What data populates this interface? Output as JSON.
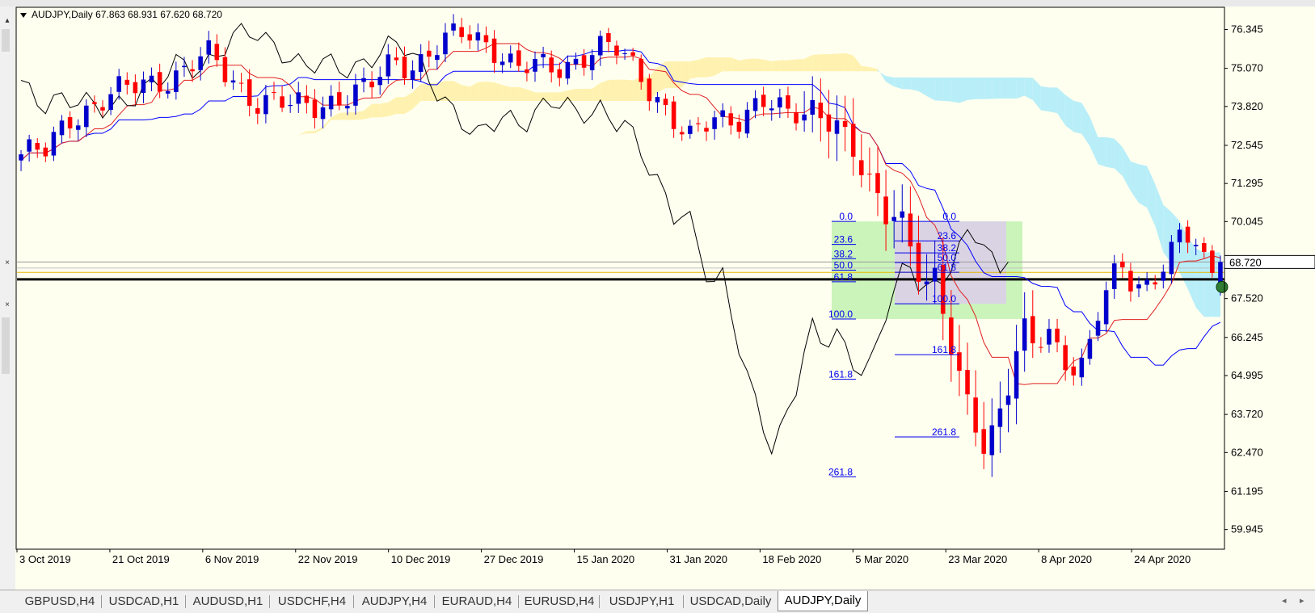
{
  "chart_data": {
    "type": "candlestick",
    "title": "AUDJPY,Daily",
    "ohlc_header": "67.863 68.931 67.620 68.720",
    "current_price": 68.72,
    "current_price_label": "68.720",
    "ylim": [
      59.3,
      77.1
    ],
    "y_ticks": [
      "76.345",
      "75.070",
      "73.820",
      "72.545",
      "71.295",
      "70.045",
      "68.720",
      "67.520",
      "66.245",
      "64.995",
      "63.720",
      "62.470",
      "61.195",
      "59.945"
    ],
    "x_ticks": [
      "3 Oct 2019",
      "21 Oct 2019",
      "6 Nov 2019",
      "22 Nov 2019",
      "10 Dec 2019",
      "27 Dec 2019",
      "15 Jan 2020",
      "31 Jan 2020",
      "18 Feb 2020",
      "5 Mar 2020",
      "23 Mar 2020",
      "8 Apr 2020",
      "24 Apr 2020"
    ],
    "horizontal_levels": [
      68.15,
      68.38,
      68.52,
      68.72
    ],
    "fib_left": {
      "p0": 70.05,
      "p100": 66.85,
      "labels": [
        "0.0",
        "23.6",
        "38.2",
        "50.0",
        "61.8",
        "100.0",
        "161.8",
        "261.8"
      ]
    },
    "fib_right": {
      "p0": 70.05,
      "p100": 67.35,
      "labels": [
        "0.0",
        "23.6",
        "38.2",
        "50.0",
        "61.8",
        "100.0",
        "161.8",
        "261.8"
      ]
    },
    "colors": {
      "bull": "#0000cc",
      "bear": "#ff0000",
      "tenkan": "#e02020",
      "kijun": "#0000ff",
      "chikou": "#000000",
      "kumo_bull": "#fff2b0",
      "kumo_bear": "#b8eef8",
      "fib": "#0000ee",
      "background": "#fffff0",
      "zone_green": "#b8f0a8",
      "zone_purple": "#ddc8f0"
    },
    "icons": {
      "menu_arrow": "dropdown-triangle-icon",
      "cursor_marker": "green-circle-marker-icon"
    }
  },
  "tabs": [
    {
      "label": "GBPUSD,H4"
    },
    {
      "label": "USDCAD,H1"
    },
    {
      "label": "AUDUSD,H1"
    },
    {
      "label": "USDCHF,H4"
    },
    {
      "label": "AUDJPY,H4"
    },
    {
      "label": "EURAUD,H4"
    },
    {
      "label": "EURUSD,H4"
    },
    {
      "label": "USDJPY,H1"
    },
    {
      "label": "USDCAD,Daily"
    },
    {
      "label": "AUDJPY,Daily",
      "active": true
    }
  ],
  "tab_nav": {
    "prev": "◂",
    "next": "▸"
  }
}
